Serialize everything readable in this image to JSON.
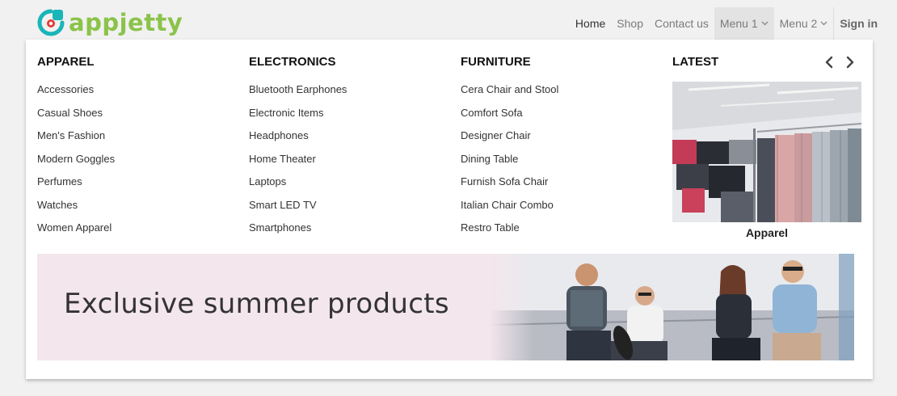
{
  "logo": {
    "text": "appjetty"
  },
  "nav": {
    "items": [
      {
        "label": "Home"
      },
      {
        "label": "Shop"
      },
      {
        "label": "Contact us"
      },
      {
        "label": "Menu 1"
      },
      {
        "label": "Menu 2"
      },
      {
        "label": "Sign in"
      }
    ]
  },
  "mega_menu": {
    "columns": [
      {
        "title": "APPAREL",
        "items": [
          "Accessories",
          "Casual Shoes",
          "Men's Fashion",
          "Modern Goggles",
          "Perfumes",
          "Watches",
          "Women Apparel"
        ]
      },
      {
        "title": "ELECTRONICS",
        "items": [
          "Bluetooth Earphones",
          "Electronic Items",
          "Headphones",
          "Home Theater",
          "Laptops",
          "Smart LED TV",
          "Smartphones"
        ]
      },
      {
        "title": "FURNITURE",
        "items": [
          "Cera Chair and Stool",
          "Comfort Sofa",
          "Designer Chair",
          "Dining Table",
          "Furnish Sofa Chair",
          "Italian Chair Combo",
          "Restro Table"
        ]
      }
    ],
    "latest": {
      "title": "LATEST",
      "caption": "Apparel"
    },
    "banner": {
      "text": "Exclusive summer products"
    }
  },
  "colors": {
    "logo_green": "#8bc34a",
    "logo_teal": "#1ab5b8",
    "logo_red": "#e53935",
    "banner_bg": "#f3e6ec"
  },
  "icons": [
    "appjetty-logo-icon",
    "chevron-down-icon",
    "chevron-left-icon",
    "chevron-right-icon"
  ]
}
